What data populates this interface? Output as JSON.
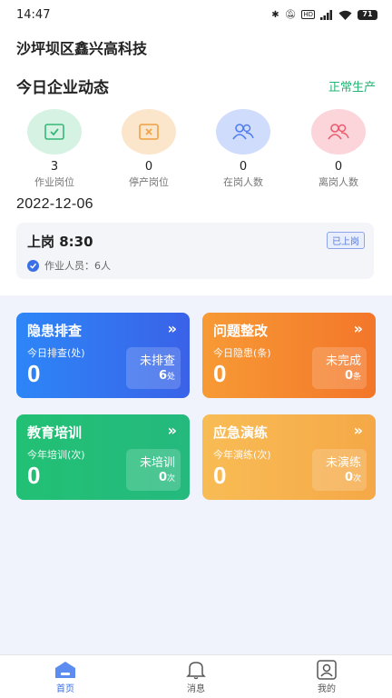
{
  "status_bar": {
    "time": "14:47",
    "icons": [
      "bluetooth-icon",
      "mute-icon",
      "hd-icon",
      "signal-icon",
      "wifi-icon"
    ],
    "battery": "71"
  },
  "company": "沙坪坝区鑫兴高科技",
  "dynamics": {
    "title": "今日企业动态",
    "status": "正常生产",
    "status_color": "#22b573"
  },
  "stats": [
    {
      "value": "3",
      "label": "作业岗位",
      "icon": "checkbox-icon",
      "color": "#d6f2e3"
    },
    {
      "value": "0",
      "label": "停产岗位",
      "icon": "x-box-icon",
      "color": "#fbe6cc"
    },
    {
      "value": "0",
      "label": "在岗人数",
      "icon": "people-icon",
      "color": "#cfdcfb"
    },
    {
      "value": "0",
      "label": "离岗人数",
      "icon": "people-icon",
      "color": "#fbd5da"
    }
  ],
  "date": "2022-12-06",
  "shift": {
    "time": "上岗 8:30",
    "badge": "已上岗",
    "workers": "作业人员：6人"
  },
  "cards": [
    {
      "title": "隐患排查",
      "arrow": "»",
      "sublabel": "今日排查(处)",
      "value": "0",
      "box_label": "未排查",
      "box_count": "6",
      "box_unit": "处"
    },
    {
      "title": "问题整改",
      "arrow": "»",
      "sublabel": "今日隐患(条)",
      "value": "0",
      "box_label": "未完成",
      "box_count": "0",
      "box_unit": "条"
    },
    {
      "title": "教育培训",
      "arrow": "»",
      "sublabel": "今年培训(次)",
      "value": "0",
      "box_label": "未培训",
      "box_count": "0",
      "box_unit": "次"
    },
    {
      "title": "应急演练",
      "arrow": "»",
      "sublabel": "今年演练(次)",
      "value": "0",
      "box_label": "未演练",
      "box_count": "0",
      "box_unit": "次"
    }
  ],
  "nav": [
    {
      "label": "首页",
      "icon": "home-icon",
      "active": true
    },
    {
      "label": "消息",
      "icon": "bell-icon",
      "active": false
    },
    {
      "label": "我的",
      "icon": "profile-icon",
      "active": false
    }
  ],
  "colors": {
    "accent": "#3a6fe6",
    "card_blue": "#2f7cf6",
    "card_orange": "#f58a2a",
    "card_green": "#22c077",
    "card_amber": "#f7b24b"
  }
}
